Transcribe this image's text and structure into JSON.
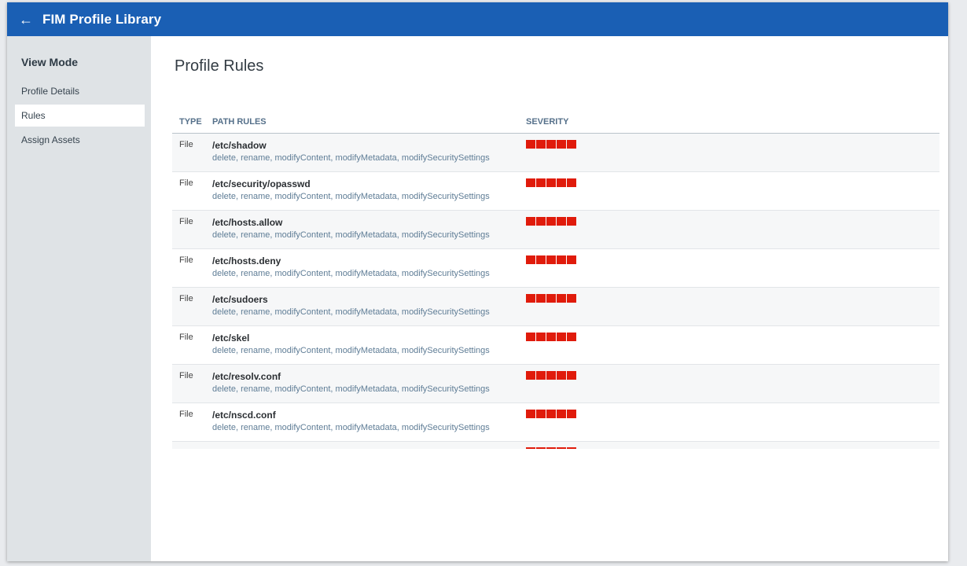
{
  "app": {
    "title": "FIM Profile Library",
    "back_icon": "arrow-left-icon"
  },
  "sidebar": {
    "heading": "View Mode",
    "items": [
      {
        "label": "Profile Details",
        "active": false
      },
      {
        "label": "Rules",
        "active": true
      },
      {
        "label": "Assign Assets",
        "active": false
      }
    ]
  },
  "main": {
    "title": "Profile Rules",
    "columns": {
      "type": "TYPE",
      "path": "PATH RULES",
      "severity": "SEVERITY"
    },
    "rules": [
      {
        "type": "File",
        "path": "/etc/shadow",
        "ops": "delete, rename, modifyContent, modifyMetadata, modifySecuritySettings",
        "severity": 5
      },
      {
        "type": "File",
        "path": "/etc/security/opasswd",
        "ops": "delete, rename, modifyContent, modifyMetadata, modifySecuritySettings",
        "severity": 5
      },
      {
        "type": "File",
        "path": "/etc/hosts.allow",
        "ops": "delete, rename, modifyContent, modifyMetadata, modifySecuritySettings",
        "severity": 5
      },
      {
        "type": "File",
        "path": "/etc/hosts.deny",
        "ops": "delete, rename, modifyContent, modifyMetadata, modifySecuritySettings",
        "severity": 5
      },
      {
        "type": "File",
        "path": "/etc/sudoers",
        "ops": "delete, rename, modifyContent, modifyMetadata, modifySecuritySettings",
        "severity": 5
      },
      {
        "type": "File",
        "path": "/etc/skel",
        "ops": "delete, rename, modifyContent, modifyMetadata, modifySecuritySettings",
        "severity": 5
      },
      {
        "type": "File",
        "path": "/etc/resolv.conf",
        "ops": "delete, rename, modifyContent, modifyMetadata, modifySecuritySettings",
        "severity": 5
      },
      {
        "type": "File",
        "path": "/etc/nscd.conf",
        "ops": "delete, rename, modifyContent, modifyMetadata, modifySecuritySettings",
        "severity": 5
      }
    ]
  },
  "colors": {
    "header": "#1a5fb4",
    "sidebar": "#dfe3e6",
    "severity": "#e01b0b"
  }
}
